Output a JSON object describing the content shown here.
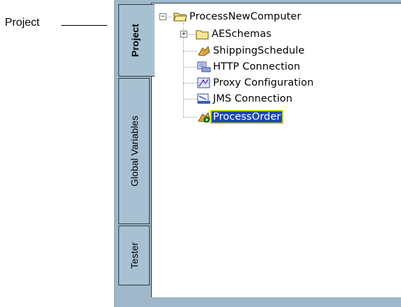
{
  "callout": {
    "label": "Project"
  },
  "tabs": [
    {
      "label": "Project",
      "active": true
    },
    {
      "label": "Global Variables",
      "active": false
    },
    {
      "label": "Tester",
      "active": false
    }
  ],
  "tree": {
    "root": {
      "label": "ProcessNewComputer",
      "icon": "open-folder-icon",
      "expanded": true
    },
    "children": [
      {
        "label": "AESchemas",
        "icon": "folder-icon",
        "collapsed": true
      },
      {
        "label": "ShippingSchedule",
        "icon": "schedule-icon"
      },
      {
        "label": "HTTP Connection",
        "icon": "http-connection-icon"
      },
      {
        "label": "Proxy Configuration",
        "icon": "proxy-configuration-icon"
      },
      {
        "label": "JMS Connection",
        "icon": "jms-connection-icon"
      },
      {
        "label": "ProcessOrder",
        "icon": "process-icon",
        "selected": true
      }
    ]
  },
  "colors": {
    "panel": "#9fb8c9",
    "selection": "#1c47b2",
    "selection_outline": "#c7d400"
  }
}
